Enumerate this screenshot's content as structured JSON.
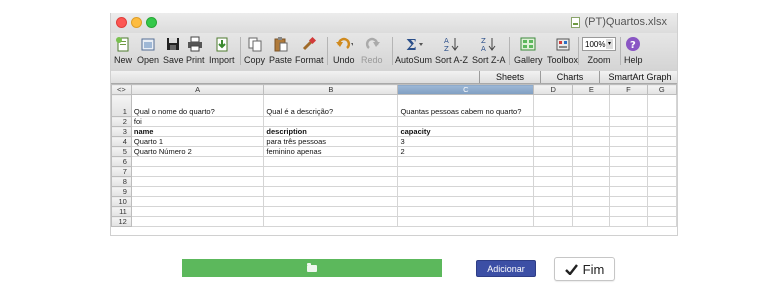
{
  "window": {
    "title": "(PT)Quartos.xlsx"
  },
  "toolbar": {
    "items": [
      {
        "label": "New",
        "icon": "new-workbook-icon"
      },
      {
        "label": "Open",
        "icon": "open-icon"
      },
      {
        "label": "Save",
        "icon": "save-icon"
      },
      {
        "label": "Print",
        "icon": "print-icon"
      },
      {
        "label": "Import",
        "icon": "import-icon"
      },
      {
        "label": "Copy",
        "icon": "copy-icon"
      },
      {
        "label": "Paste",
        "icon": "paste-icon"
      },
      {
        "label": "Format",
        "icon": "format-brush-icon"
      },
      {
        "label": "Undo",
        "icon": "undo-icon"
      },
      {
        "label": "Redo",
        "icon": "redo-icon"
      },
      {
        "label": "AutoSum",
        "icon": "sigma-icon"
      },
      {
        "label": "Sort A-Z",
        "icon": "sort-az-icon"
      },
      {
        "label": "Sort Z-A",
        "icon": "sort-za-icon"
      },
      {
        "label": "Gallery",
        "icon": "gallery-icon"
      },
      {
        "label": "Toolbox",
        "icon": "toolbox-icon"
      },
      {
        "label": "Zoom",
        "icon": "zoom-icon"
      },
      {
        "label": "Help",
        "icon": "help-icon"
      }
    ],
    "zoom_value": "100%"
  },
  "ribbon": {
    "tabs": [
      "Sheets",
      "Charts",
      "SmartArt Graph"
    ]
  },
  "sheet": {
    "corner": "<>",
    "columns": [
      "A",
      "B",
      "C",
      "D",
      "E",
      "F",
      "G"
    ],
    "selected_column": "C",
    "rows": [
      {
        "num": "1",
        "cells": [
          "Qual o nome do quarto?",
          "Qual é a descrição?",
          "Quantas pessoas cabem no quarto?"
        ]
      },
      {
        "num": "2",
        "cells": [
          "foi",
          "",
          ""
        ]
      },
      {
        "num": "3",
        "cells": [
          "name",
          "description",
          "capacity"
        ]
      },
      {
        "num": "4",
        "cells": [
          "Quarto 1",
          "para três pessoas",
          "3"
        ]
      },
      {
        "num": "5",
        "cells": [
          "Quarto Número 2",
          "feminino apenas",
          "2"
        ]
      },
      {
        "num": "6",
        "cells": [
          "",
          "",
          ""
        ]
      },
      {
        "num": "7",
        "cells": [
          "",
          "",
          ""
        ]
      },
      {
        "num": "8",
        "cells": [
          "",
          "",
          ""
        ]
      },
      {
        "num": "9",
        "cells": [
          "",
          "",
          ""
        ]
      },
      {
        "num": "10",
        "cells": [
          "",
          "",
          ""
        ]
      },
      {
        "num": "11",
        "cells": [
          "",
          "",
          ""
        ]
      },
      {
        "num": "12",
        "cells": [
          "",
          "",
          ""
        ]
      }
    ]
  },
  "upload": {
    "progress": 1.0,
    "icon": "folder-open-icon",
    "color": "#5cb85c"
  },
  "actions": {
    "add_label": "Adicionar",
    "finish_label": "Fim",
    "add_color": "#3c4fa5"
  }
}
